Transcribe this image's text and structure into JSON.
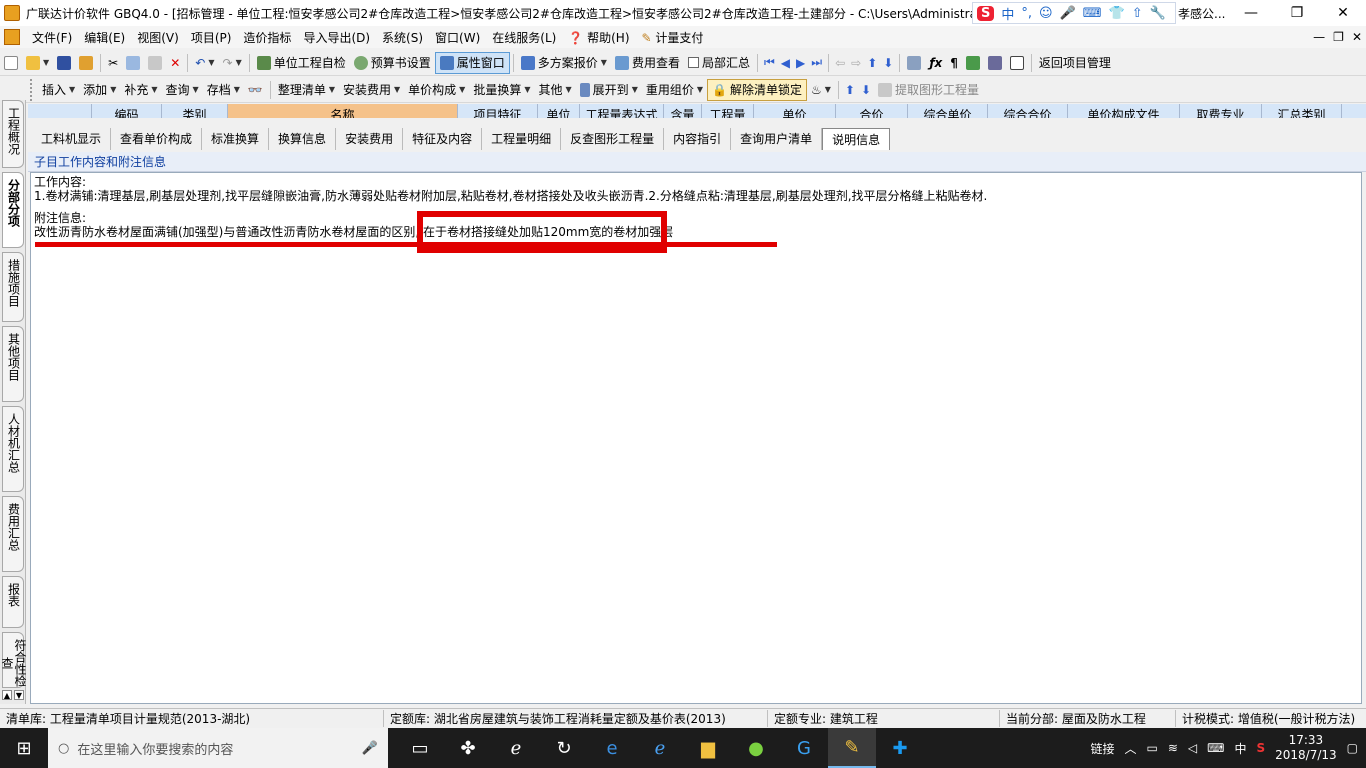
{
  "window": {
    "title": "广联达计价软件 GBQ4.0 - [招标管理 - 单位工程:恒安孝感公司2#仓库改造工程>恒安孝感公司2#仓库改造工程>恒安孝感公司2#仓库改造工程-土建部分 - C:\\Users\\Administrat",
    "title_tail": "孝感公...",
    "controls": [
      "—",
      "❐",
      "✕"
    ]
  },
  "ime": {
    "logo": "S",
    "items": [
      "中",
      "°,",
      "☺",
      "🎤",
      "⌨",
      "👕",
      "⇧",
      "🔧"
    ]
  },
  "menu": {
    "items": [
      "文件(F)",
      "编辑(E)",
      "视图(V)",
      "项目(P)",
      "造价指标",
      "导入导出(D)",
      "系统(S)",
      "窗口(W)",
      "在线服务(L)",
      "帮助(H)",
      "计量支付"
    ],
    "mdi": [
      "—",
      "❐",
      "✕"
    ]
  },
  "toolbar1": {
    "unit_check": "单位工程自检",
    "budget_settings": "预算书设置",
    "property_window": "属性窗口",
    "multi_quote": "多方案报价",
    "fee_view": "费用查看",
    "local_summary": "局部汇总",
    "back_project": "返回项目管理"
  },
  "toolbar2": {
    "insert": "插入",
    "add": "添加",
    "supplement": "补充",
    "query": "查询",
    "archive": "存档",
    "organize": "整理清单",
    "install_fee": "安装费用",
    "unit_price_comp": "单价构成",
    "batch_convert": "批量换算",
    "other": "其他",
    "expand_to": "展开到",
    "reuse_price": "重用组价",
    "unlock": "解除清单锁定",
    "extract": "提取图形工程量"
  },
  "sidebar": {
    "tabs": [
      "工程概况",
      "分部分项",
      "措施项目",
      "其他项目",
      "人材机汇总",
      "费用汇总",
      "报表",
      "符合性检查"
    ]
  },
  "grid_header": [
    "编码",
    "类别",
    "名称",
    "项目特征",
    "单位",
    "工程量表达式",
    "含量",
    "工程量",
    "单价",
    "合价",
    "综合单价",
    "综合合价",
    "单价构成文件",
    "取费专业",
    "汇总类别"
  ],
  "subtabs": [
    "工料机显示",
    "查看单价构成",
    "标准换算",
    "换算信息",
    "安装费用",
    "特征及内容",
    "工程量明细",
    "反查图形工程量",
    "内容指引",
    "查询用户清单",
    "说明信息"
  ],
  "section_title": "子目工作内容和附注信息",
  "content": {
    "work_label": "工作内容:",
    "work_text": "1.卷材满铺:清理基层,刷基层处理剂,找平层缝隙嵌油膏,防水薄弱处贴卷材附加层,粘贴卷材,卷材搭接处及收头嵌沥青.2.分格缝点粘:清理基层,刷基层处理剂,找平层分格缝上粘贴卷材.",
    "note_label": "附注信息:",
    "note_text_a": "改性沥青防水卷材屋面满铺(加强型)与普通改性沥青防水卷材屋面的区别",
    "note_text_b": "在于卷材搭接缝处加贴120mm宽的卷材加强层"
  },
  "status": {
    "list_lib": "清单库:  工程量清单项目计量规范(2013-湖北)",
    "quota_lib": "定额库:  湖北省房屋建筑与装饰工程消耗量定额及基价表(2013)",
    "quota_major": "定额专业:  建筑工程",
    "current_part": "当前分部:  屋面及防水工程",
    "tax_mode": "计税模式:  增值税(一般计税方法)"
  },
  "taskbar": {
    "search_placeholder": "在这里输入你要搜索的内容",
    "tray_link": "链接",
    "tray_lang": "中",
    "time": "17:33",
    "date": "2018/7/13"
  },
  "colors": {
    "highlight_red": "#e00000",
    "grid_header_bg": "#d6e6f8",
    "selected_col": "#f5c28a"
  }
}
